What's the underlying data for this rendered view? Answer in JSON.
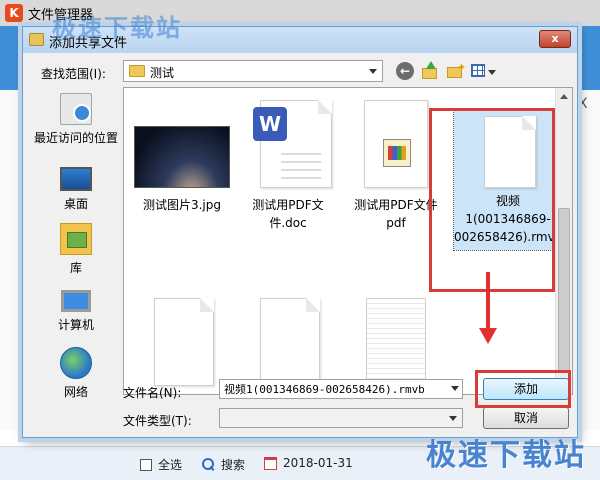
{
  "background_app": {
    "title": "文件管理器",
    "logo": "K",
    "close_glyph": "X",
    "footer": {
      "select_all": "全选",
      "search": "搜索",
      "date": "2018-01-31"
    }
  },
  "dialog": {
    "title": "添加共享文件",
    "close_glyph": "x",
    "look_in_label": "查找范围(I):",
    "look_in_value": "测试",
    "back_glyph": "←",
    "new_folder_glyph": "✦",
    "places": [
      {
        "label": "最近访问的位置"
      },
      {
        "label": "桌面"
      },
      {
        "label": "库"
      },
      {
        "label": "计算机"
      },
      {
        "label": "网络"
      }
    ],
    "files": [
      {
        "name": "测试图片3.jpg"
      },
      {
        "name": "测试用PDF文件.doc",
        "badge": "W"
      },
      {
        "name": "测试用PDF文件pdf"
      },
      {
        "name": "视频1(001346869-002658426).rmvb"
      }
    ],
    "file_name_label": "文件名(N):",
    "file_name_value": "视频1(001346869-002658426).rmvb",
    "file_type_label": "文件类型(T):",
    "file_type_value": "",
    "add_button": "添加",
    "cancel_button": "取消"
  },
  "watermark": "极速下载站",
  "colors": {
    "annotation_red": "#d93a3a",
    "brand_blue": "#3f8fd8"
  }
}
